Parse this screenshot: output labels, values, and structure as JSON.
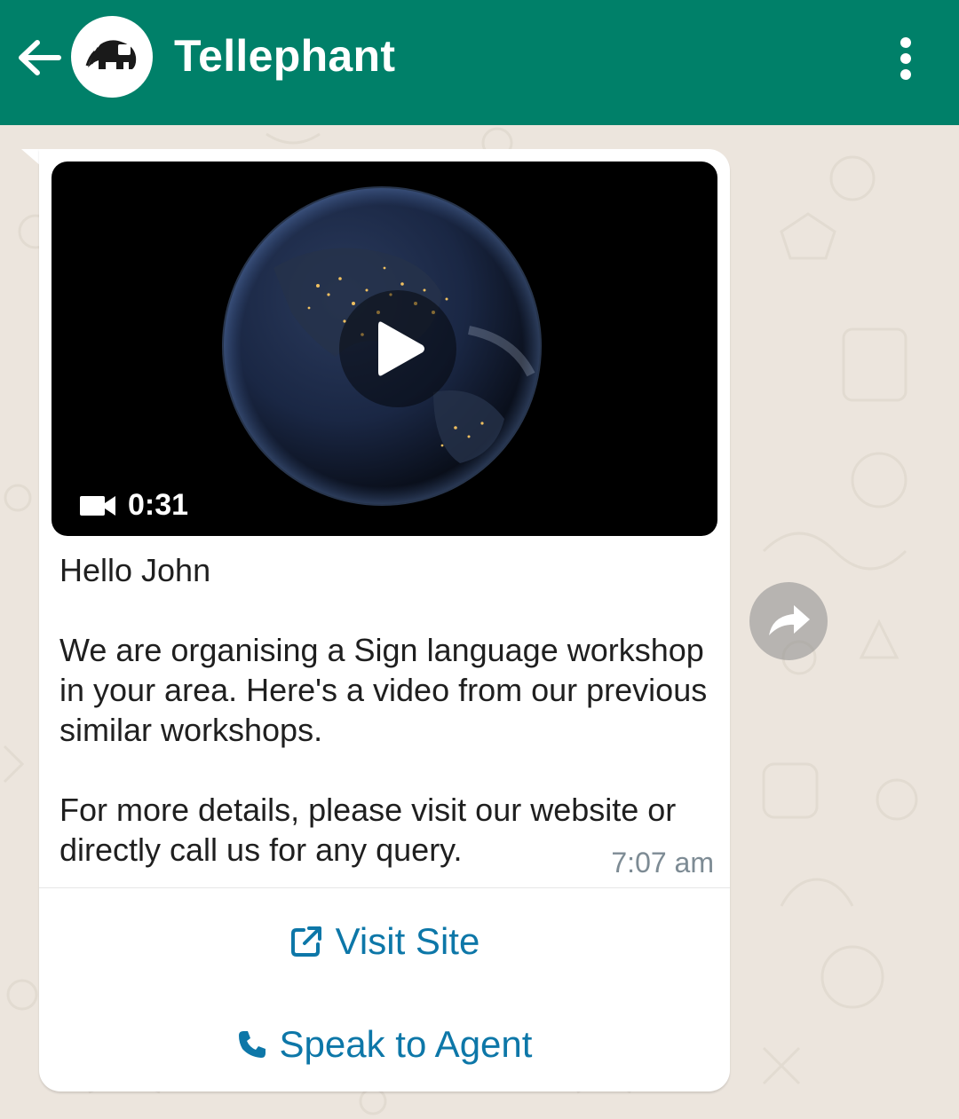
{
  "header": {
    "title": "Tellephant",
    "back_icon": "arrow-left-icon",
    "avatar_icon": "elephant-logo-icon",
    "menu_icon": "more-vertical-icon",
    "color": "#008069"
  },
  "message": {
    "video": {
      "duration": "0:31",
      "duration_icon": "video-camera-icon",
      "play_icon": "play-icon"
    },
    "greeting": "Hello John",
    "body_1": "We are organising a Sign language workshop in your area. Here's a video from our previous similar workshops.",
    "body_2": "For more details, please visit our website or directly call us for any query.",
    "time": "7:07 am",
    "actions": [
      {
        "label": "Visit Site",
        "icon": "external-link-icon"
      },
      {
        "label": "Speak to Agent",
        "icon": "phone-icon"
      }
    ],
    "action_color": "#0d77a8"
  },
  "forward_icon": "forward-icon",
  "background_color": "#ece5dd"
}
